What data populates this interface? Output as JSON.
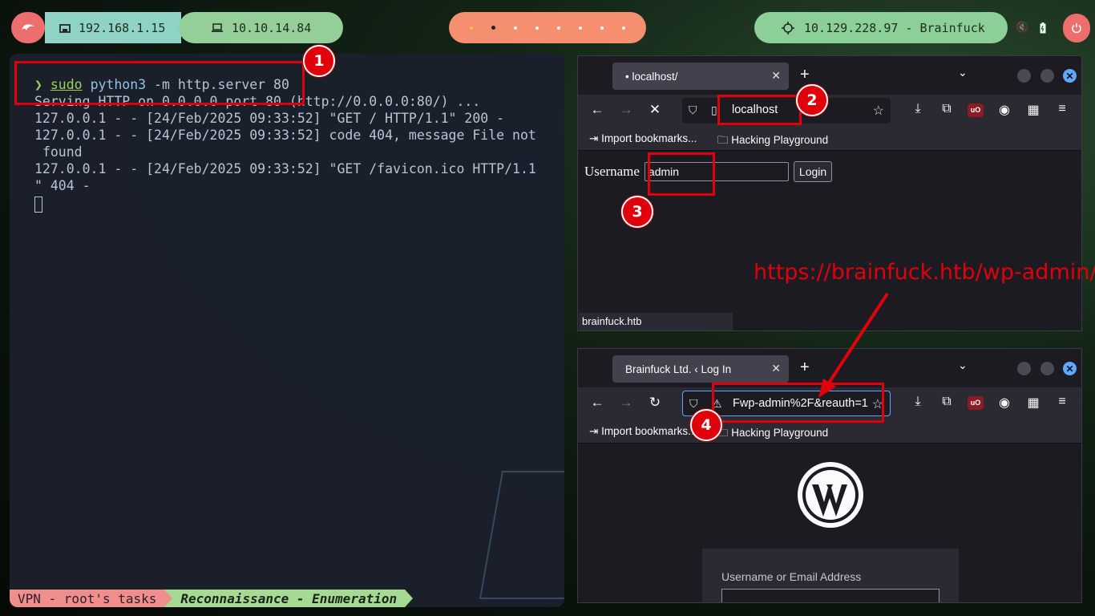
{
  "topbar": {
    "kali_icon": "kali-dragon-icon",
    "local_ip": "192.168.1.15",
    "vpn_ip": "10.10.14.84",
    "target": "10.129.228.97 - Brainfuck",
    "workspace_count": 8,
    "active_workspace": 2
  },
  "terminal": {
    "prompt_symbol": "❯",
    "cmd_sudo": "sudo",
    "cmd_python": "python3",
    "cmd_args": " -m http.server 80",
    "output": [
      "Serving HTTP on 0.0.0.0 port 80 (http://0.0.0.0:80/) ...",
      "127.0.0.1 - - [24/Feb/2025 09:33:52] \"GET / HTTP/1.1\" 200 -",
      "127.0.0.1 - - [24/Feb/2025 09:33:52] code 404, message File not",
      " found",
      "127.0.0.1 - - [24/Feb/2025 09:33:52] \"GET /favicon.ico HTTP/1.1",
      "\" 404 -"
    ],
    "status_left": "VPN - root's tasks",
    "status_right": "Reconnaissance - Enumeration"
  },
  "browser1": {
    "tab_title": "• localhost/",
    "url": "localhost",
    "bookmarks": [
      "Import bookmarks...",
      "Hacking Playground"
    ],
    "form": {
      "label": "Username",
      "value": "admin",
      "button": "Login"
    },
    "status_url": "brainfuck.htb"
  },
  "browser2": {
    "tab_title": "Brainfuck Ltd. ‹ Log In",
    "url": "Fwp-admin%2F&reauth=1",
    "bookmarks": [
      "Import bookmarks...",
      "Hacking Playground"
    ],
    "wp_label": "Username or Email Address"
  },
  "annotations": {
    "markers": [
      "1",
      "2",
      "3",
      "4"
    ],
    "url_text": "https://brainfuck.htb/wp-admin/",
    "color": "#e0000b"
  }
}
